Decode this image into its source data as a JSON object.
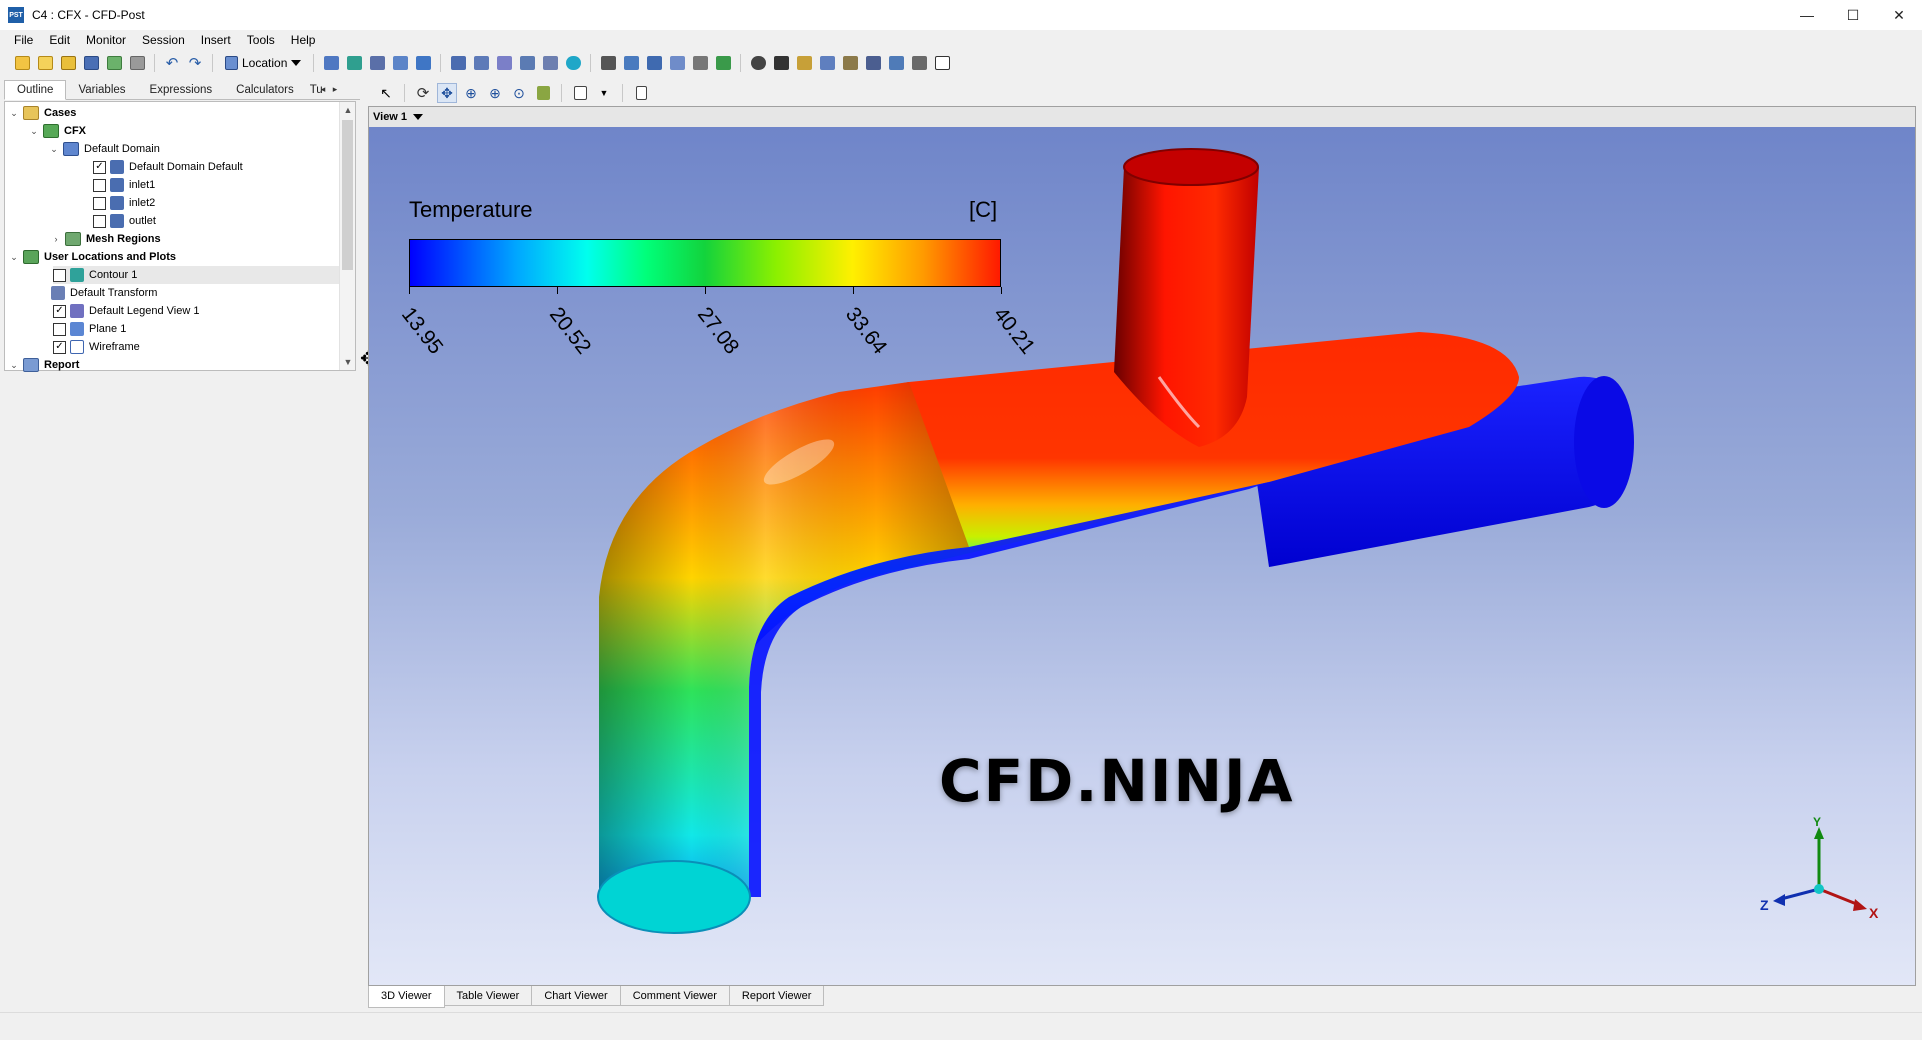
{
  "window": {
    "app_icon_text": "PST",
    "title": "C4 : CFX - CFD-Post",
    "minimize": "—",
    "maximize": "☐",
    "close": "✕"
  },
  "menu": [
    "File",
    "Edit",
    "Monitor",
    "Session",
    "Insert",
    "Tools",
    "Help"
  ],
  "toolbar": {
    "location_label": "Location"
  },
  "left_tabs": [
    "Outline",
    "Variables",
    "Expressions",
    "Calculators",
    "Tu"
  ],
  "tree": [
    {
      "label": "Cases",
      "bold": true,
      "expander": "v"
    },
    {
      "label": "CFX",
      "bold": true,
      "expander": "v"
    },
    {
      "label": "Default Domain",
      "bold": false,
      "expander": "v"
    },
    {
      "label": "Default Domain Default",
      "checked": true
    },
    {
      "label": "inlet1",
      "checked": false
    },
    {
      "label": "inlet2",
      "checked": false
    },
    {
      "label": "outlet",
      "checked": false
    },
    {
      "label": "Mesh Regions",
      "bold": true,
      "expander": ">"
    },
    {
      "label": "User Locations and Plots",
      "bold": true,
      "expander": "v"
    },
    {
      "label": "Contour 1",
      "checked": false
    },
    {
      "label": "Default Transform"
    },
    {
      "label": "Default Legend View 1",
      "checked": true
    },
    {
      "label": "Plane 1",
      "checked": false
    },
    {
      "label": "Wireframe",
      "checked": true
    },
    {
      "label": "Report",
      "bold": true,
      "expander": "v"
    }
  ],
  "viewer": {
    "name": "View 1",
    "legend_title": "Temperature",
    "legend_unit": "[C]",
    "legend_ticks": [
      "13.95",
      "20.52",
      "27.08",
      "33.64",
      "40.21"
    ],
    "watermark": "CFD.NINJA",
    "axes": {
      "x": "X",
      "y": "Y",
      "z": "Z"
    }
  },
  "viewer_tabs": [
    "3D Viewer",
    "Table Viewer",
    "Chart Viewer",
    "Comment Viewer",
    "Report Viewer"
  ],
  "colors": {
    "hot": "#ff1a00",
    "cold": "#0000ff",
    "background_top": "#6f85c9",
    "background_bottom": "#e2e7f7"
  }
}
